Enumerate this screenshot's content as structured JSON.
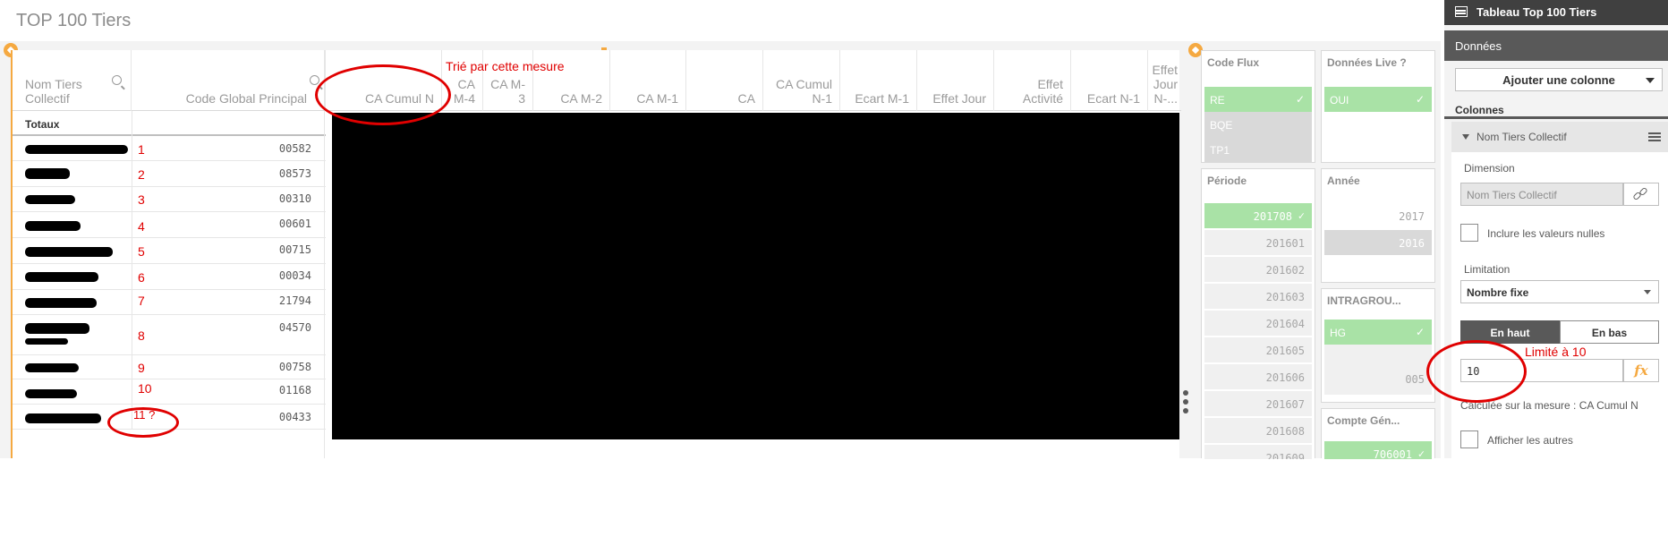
{
  "sheet": {
    "title": "TOP 100 Tiers"
  },
  "table": {
    "columns": [
      "Nom Tiers Collectif",
      "Code Global Principal",
      "CA Cumul N",
      "CA M-4",
      "CA M-3",
      "CA M-2",
      "CA M-1",
      "CA",
      "CA Cumul N-1",
      "Ecart M-1",
      "Effet Jour",
      "Effet Activité",
      "Ecart N-1",
      "Effet Jour N-..."
    ],
    "totals_label": "Totaux",
    "rows": [
      {
        "num": "1",
        "code": "00582"
      },
      {
        "num": "2",
        "code": "08573"
      },
      {
        "num": "3",
        "code": "00310"
      },
      {
        "num": "4",
        "code": "00601"
      },
      {
        "num": "5",
        "code": "00715"
      },
      {
        "num": "6",
        "code": "00034"
      },
      {
        "num": "7",
        "code": "21794"
      },
      {
        "num": "8",
        "code": "04570"
      },
      {
        "num": "9",
        "code": "00758"
      },
      {
        "num": "10",
        "code": "01168"
      },
      {
        "num": "11 ?",
        "code": "00433"
      }
    ]
  },
  "filters": {
    "code_flux": {
      "title": "Code Flux",
      "items": [
        "RE",
        "BQE",
        "TP1"
      ]
    },
    "donnees_live": {
      "title": "Données Live ?",
      "items": [
        "OUI"
      ]
    },
    "periode": {
      "title": "Période",
      "items": [
        "201708",
        "201601",
        "201602",
        "201603",
        "201604",
        "201605",
        "201606",
        "201607",
        "201608",
        "201609"
      ]
    },
    "annee": {
      "title": "Année",
      "items": [
        "2017",
        "2016"
      ]
    },
    "intragroupe": {
      "title": "INTRAGROU...",
      "items": [
        "HG",
        "005"
      ]
    },
    "compte_gen": {
      "title": "Compte Gén...",
      "items": [
        "706001"
      ]
    }
  },
  "panel": {
    "header": "Tableau Top 100 Tiers",
    "tab": "Données",
    "add_column": "Ajouter une colonne",
    "columns_section": "Colonnes",
    "column_name": "Nom Tiers Collectif",
    "dimension_label": "Dimension",
    "dimension_value": "Nom Tiers Collectif",
    "include_nulls": "Inclure les valeurs nulles",
    "limitation_label": "Limitation",
    "limitation_value": "Nombre fixe",
    "top_label": "En haut",
    "bottom_label": "En bas",
    "limit_value": "10",
    "fx_label": "fx",
    "calculated_on": "Calculée sur la mesure : CA Cumul N",
    "show_others": "Afficher les autres"
  },
  "annotations": {
    "sorted_by": "Trié par cette mesure",
    "limited_to": "Limité à 10"
  },
  "colors": {
    "accent": "#f5a941",
    "selected": "#a9e2a6",
    "annotation": "#e00000"
  }
}
